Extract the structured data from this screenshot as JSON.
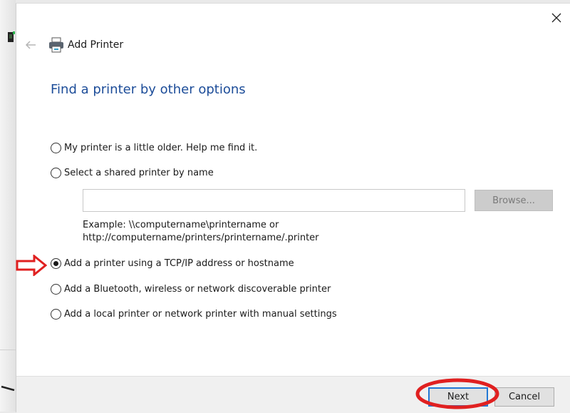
{
  "window": {
    "title": "Add Printer",
    "close_icon": "close-icon",
    "back_icon": "back-arrow-icon",
    "app_icon": "printer-icon"
  },
  "main": {
    "heading": "Find a printer by other options",
    "options": [
      {
        "label": "My printer is a little older. Help me find it.",
        "selected": false
      },
      {
        "label": "Select a shared printer by name",
        "selected": false
      },
      {
        "label": "Add a printer using a TCP/IP address or hostname",
        "selected": true
      },
      {
        "label": "Add a Bluetooth, wireless or network discoverable printer",
        "selected": false
      },
      {
        "label": "Add a local printer or network printer with manual settings",
        "selected": false
      }
    ],
    "shared_printer_input": {
      "value": "",
      "placeholder": ""
    },
    "browse_label": "Browse...",
    "example_line1": "Example: \\\\computername\\printername or",
    "example_line2": "http://computername/printers/printername/.printer"
  },
  "footer": {
    "next_label": "Next",
    "cancel_label": "Cancel"
  },
  "annotations": {
    "arrow_color": "#e02020",
    "ellipse_color": "#e02020"
  },
  "colors": {
    "heading": "#1d4d99",
    "default_button_border": "#2277d4"
  }
}
